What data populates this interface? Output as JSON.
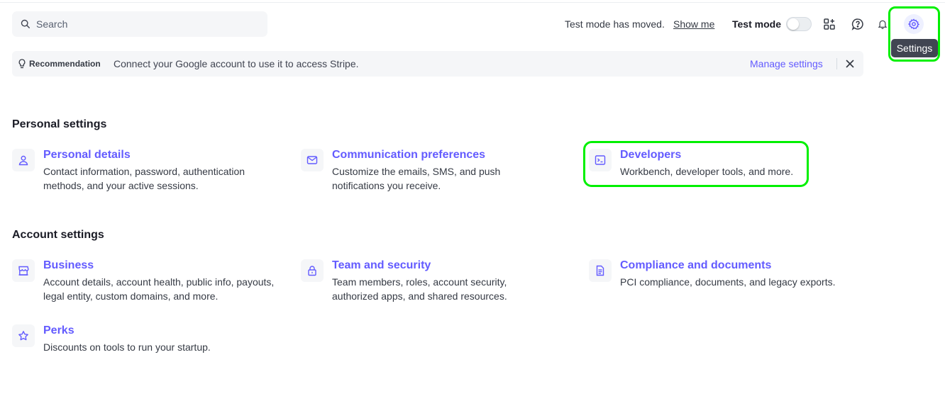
{
  "search": {
    "placeholder": "Search"
  },
  "topbar": {
    "test_mode_moved": "Test mode has moved.",
    "show_me": "Show me",
    "test_mode_label": "Test mode",
    "test_mode_on": false,
    "tooltip": "Settings",
    "accent": "#635bff",
    "icons": [
      "apps-icon",
      "help-icon",
      "bell-icon",
      "gear-icon"
    ]
  },
  "banner": {
    "tag": "Recommendation",
    "message": "Connect your Google account to use it to access Stripe.",
    "action": "Manage settings"
  },
  "personal": {
    "title": "Personal settings",
    "items": [
      {
        "icon": "user-icon",
        "title": "Personal details",
        "desc": "Contact information, password, authentication methods, and your active sessions."
      },
      {
        "icon": "mail-icon",
        "title": "Communication preferences",
        "desc": "Customize the emails, SMS, and push notifications you receive."
      },
      {
        "icon": "terminal-icon",
        "title": "Developers",
        "desc": "Workbench, developer tools, and more."
      }
    ]
  },
  "account": {
    "title": "Account settings",
    "items": [
      {
        "icon": "store-icon",
        "title": "Business",
        "desc": "Account details, account health, public info, payouts, legal entity, custom domains, and more."
      },
      {
        "icon": "lock-icon",
        "title": "Team and security",
        "desc": "Team members, roles, account security, authorized apps, and shared resources."
      },
      {
        "icon": "document-icon",
        "title": "Compliance and documents",
        "desc": "PCI compliance, documents, and legacy exports."
      },
      {
        "icon": "star-icon",
        "title": "Perks",
        "desc": "Discounts on tools to run your startup."
      }
    ]
  }
}
